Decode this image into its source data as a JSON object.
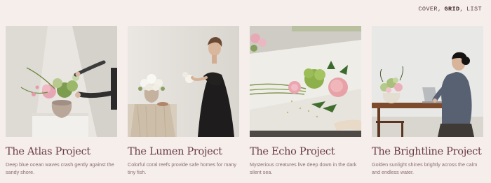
{
  "view_switch": {
    "options": [
      {
        "label": "COVER",
        "active": false
      },
      {
        "label": "GRID",
        "active": true
      },
      {
        "label": "LIST",
        "active": false
      }
    ]
  },
  "projects": [
    {
      "title": "The Atlas Project",
      "description": "Deep blue ocean waves crash gently against the sandy shore."
    },
    {
      "title": "The Lumen Project",
      "description": "Colorful coral reefs provide safe homes for many tiny fish."
    },
    {
      "title": "The Echo Project",
      "description": "Mysterious creatures live deep down in the dark silent sea."
    },
    {
      "title": "The Brightline Project",
      "description": "Golden sunlight shines brightly across the calm and endless water."
    }
  ],
  "colors": {
    "background": "#f5eeeb",
    "title": "#6c3c45",
    "description": "#8d6d72"
  }
}
